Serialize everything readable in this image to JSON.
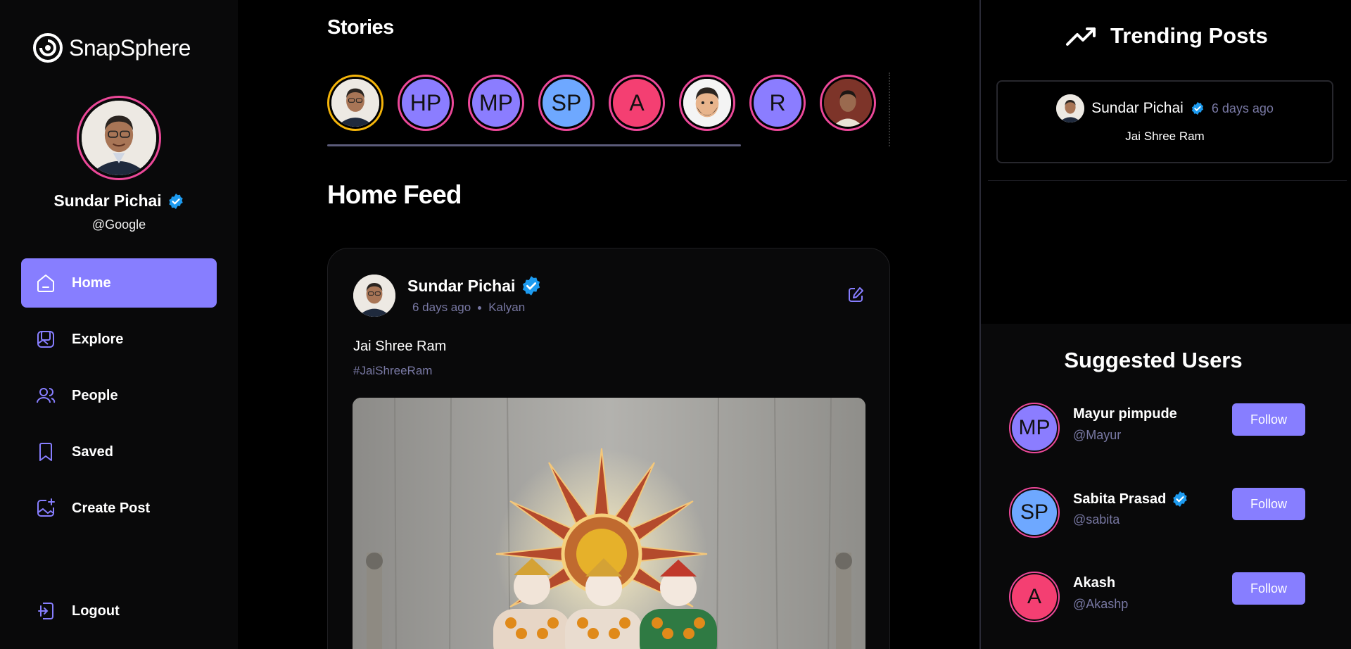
{
  "app": {
    "name": "SnapSphere"
  },
  "profile": {
    "name": "Sundar Pichai",
    "handle": "@Google"
  },
  "nav": [
    {
      "label": "Home",
      "icon": "home-icon",
      "active": true
    },
    {
      "label": "Explore",
      "icon": "gallery-icon"
    },
    {
      "label": "People",
      "icon": "people-icon"
    },
    {
      "label": "Saved",
      "icon": "bookmark-icon"
    },
    {
      "label": "Create Post",
      "icon": "gallery-add-icon"
    }
  ],
  "logout": {
    "label": "Logout"
  },
  "stories": {
    "title": "Stories",
    "items": [
      {
        "type": "photo",
        "name": "own-story"
      },
      {
        "initials": "HP",
        "color": "#8b7dff"
      },
      {
        "initials": "MP",
        "color": "#8b7dff"
      },
      {
        "initials": "SP",
        "color": "#6ea8ff"
      },
      {
        "initials": "A",
        "color": "#f43f72"
      },
      {
        "type": "emoji",
        "name": "memoji"
      },
      {
        "initials": "R",
        "color": "#8b7dff"
      },
      {
        "type": "photo2",
        "name": "photo-story"
      }
    ]
  },
  "feed": {
    "title": "Home Feed",
    "post": {
      "author": "Sundar Pichai",
      "time": "6 days ago",
      "location": "Kalyan",
      "caption": "Jai Shree Ram",
      "tag": "#JaiShreeRam"
    }
  },
  "trending": {
    "title": "Trending Posts",
    "post": {
      "author": "Sundar Pichai",
      "time": "6 days ago",
      "caption": "Jai Shree Ram"
    }
  },
  "suggested": {
    "title": "Suggested Users",
    "users": [
      {
        "initials": "MP",
        "color": "#8b7dff",
        "name": "Mayur pimpude",
        "handle": "@Mayur",
        "verified": false,
        "button": "Follow"
      },
      {
        "initials": "SP",
        "color": "#6ea8ff",
        "name": "Sabita Prasad",
        "handle": "@sabita",
        "verified": true,
        "button": "Follow"
      },
      {
        "initials": "A",
        "color": "#f43f72",
        "name": "Akash",
        "handle": "@Akashp",
        "verified": false,
        "button": "Follow"
      }
    ]
  },
  "colors": {
    "accent": "#877eff",
    "ring": "#ec4899",
    "muted": "#7878a3",
    "verified": "#0095f6"
  }
}
